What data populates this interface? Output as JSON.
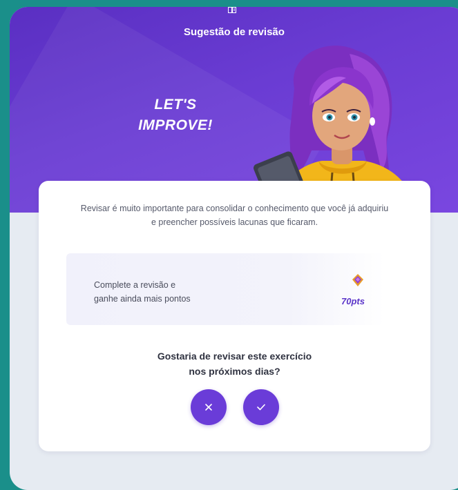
{
  "header": {
    "title": "Sugestão de revisão",
    "icon": "book-icon"
  },
  "hero": {
    "line1": "LET'S",
    "line2": "IMPROVE!"
  },
  "card": {
    "intro": "Revisar é muito importante para consolidar o conhecimento que você já adquiriu e preencher possíveis lacunas que ficaram.",
    "reward": {
      "line1": "Complete a revisão e",
      "line2": "ganhe ainda mais pontos",
      "points": "70pts",
      "icon": "gem-icon"
    },
    "question": {
      "line1": "Gostaria de revisar este exercício",
      "line2": "nos próximos dias?"
    },
    "buttons": {
      "decline_icon": "close-icon",
      "accept_icon": "check-icon"
    }
  },
  "colors": {
    "accent": "#6a3cd8",
    "banner": "#6a3cd3",
    "background": "#e6ebf2",
    "points": "#5b35c9"
  }
}
